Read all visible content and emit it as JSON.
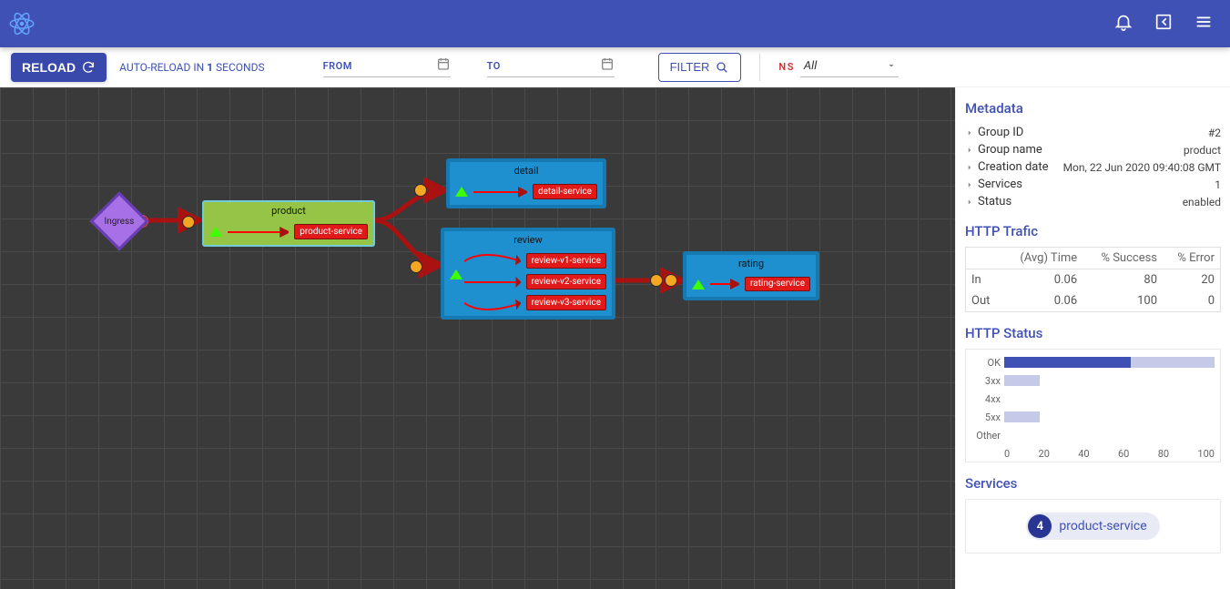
{
  "toolbar": {
    "reload_label": "RELOAD",
    "auto_reload_prefix": "AUTO-RELOAD IN ",
    "auto_reload_seconds": "1",
    "auto_reload_suffix": " SECONDS",
    "from_label": "FROM",
    "to_label": "TO",
    "filter_label": "FILTER",
    "ns_label": "NS",
    "ns_value": "All"
  },
  "graph": {
    "ingress_label": "Ingress",
    "nodes": {
      "product": {
        "title": "product",
        "services": [
          "product-service"
        ]
      },
      "detail": {
        "title": "detail",
        "services": [
          "detail-service"
        ]
      },
      "review": {
        "title": "review",
        "services": [
          "review-v1-service",
          "review-v2-service",
          "review-v3-service"
        ]
      },
      "rating": {
        "title": "rating",
        "services": [
          "rating-service"
        ]
      }
    }
  },
  "sidebar": {
    "metadata_heading": "Metadata",
    "meta": [
      {
        "label": "Group ID",
        "value": "#2"
      },
      {
        "label": "Group name",
        "value": "product"
      },
      {
        "label": "Creation date",
        "value": "Mon, 22 Jun 2020 09:40:08 GMT"
      },
      {
        "label": "Services",
        "value": "1"
      },
      {
        "label": "Status",
        "value": "enabled"
      }
    ],
    "traffic_heading": "HTTP Trafic",
    "traffic_headers": [
      "",
      "(Avg) Time",
      "% Success",
      "% Error"
    ],
    "traffic_rows": [
      {
        "dir": "In",
        "time": "0.06",
        "success": "80",
        "error": "20"
      },
      {
        "dir": "Out",
        "time": "0.06",
        "success": "100",
        "error": "0"
      }
    ],
    "status_heading": "HTTP Status",
    "services_heading": "Services",
    "service_chip": {
      "count": "4",
      "name": "product-service"
    }
  },
  "chart_data": {
    "type": "bar",
    "orientation": "horizontal",
    "stacked": true,
    "categories": [
      "OK",
      "3xx",
      "4xx",
      "5xx",
      "Other"
    ],
    "series": [
      {
        "name": "primary",
        "values": [
          60,
          0,
          0,
          0,
          0
        ]
      },
      {
        "name": "secondary",
        "values": [
          40,
          17,
          0,
          17,
          0
        ]
      }
    ],
    "xlim": [
      0,
      100
    ],
    "xticks": [
      0,
      20,
      40,
      60,
      80,
      100
    ]
  }
}
